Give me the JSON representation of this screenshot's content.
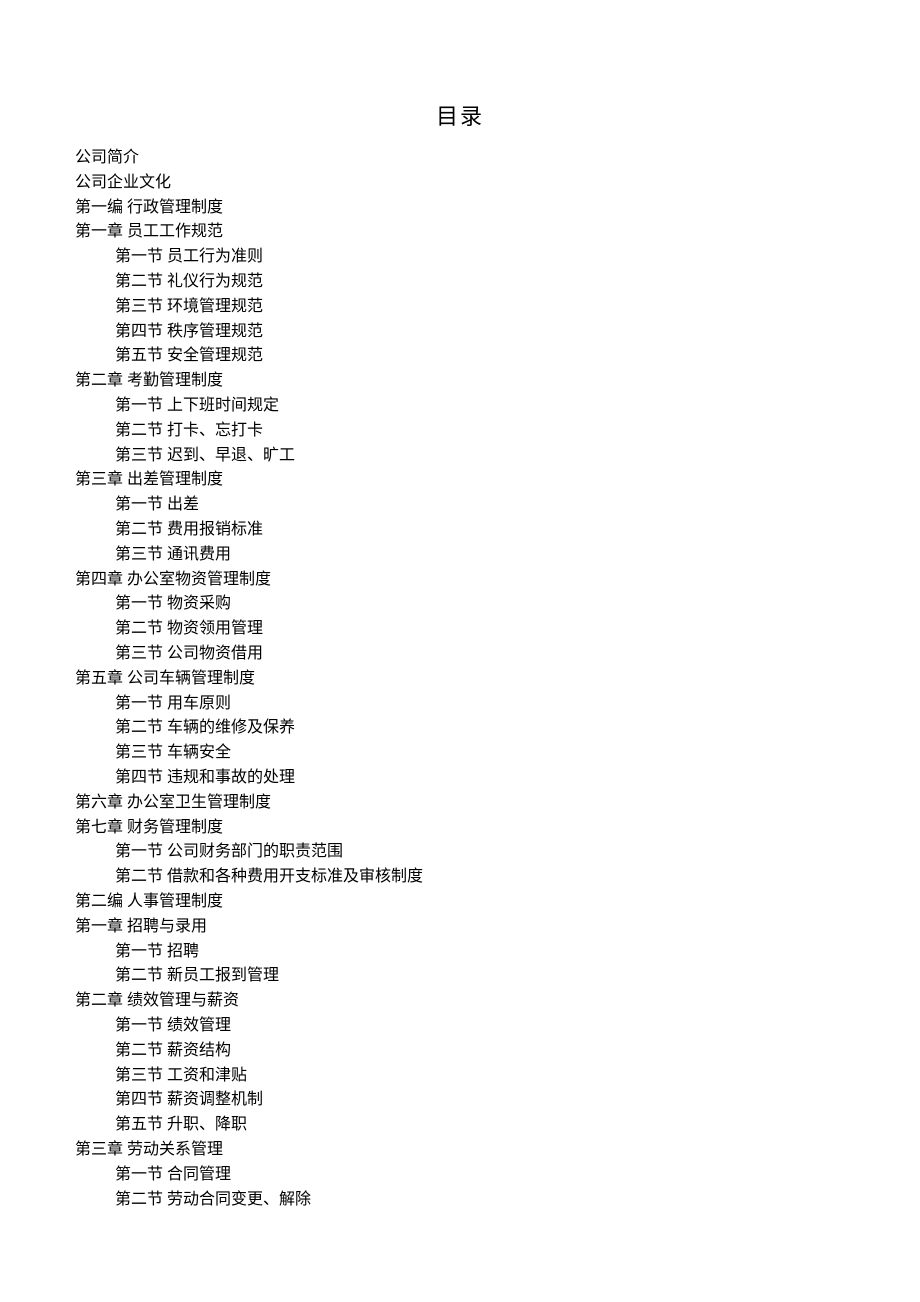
{
  "title": "目录",
  "items": [
    {
      "text": "公司简介",
      "level": 0
    },
    {
      "text": "公司企业文化",
      "level": 0
    },
    {
      "text": "第一编 行政管理制度",
      "level": 0
    },
    {
      "text": "第一章 员工工作规范",
      "level": 0
    },
    {
      "text": "第一节 员工行为准则",
      "level": 1
    },
    {
      "text": "第二节 礼仪行为规范",
      "level": 1
    },
    {
      "text": "第三节 环境管理规范",
      "level": 1
    },
    {
      "text": "第四节 秩序管理规范",
      "level": 1
    },
    {
      "text": "第五节 安全管理规范",
      "level": 1
    },
    {
      "text": "第二章 考勤管理制度",
      "level": 0
    },
    {
      "text": "第一节 上下班时间规定",
      "level": 1
    },
    {
      "text": "第二节 打卡、忘打卡",
      "level": 1
    },
    {
      "text": "第三节 迟到、早退、旷工",
      "level": 1
    },
    {
      "text": "第三章 出差管理制度",
      "level": 0
    },
    {
      "text": "第一节 出差",
      "level": 1
    },
    {
      "text": "第二节 费用报销标准",
      "level": 1
    },
    {
      "text": "第三节 通讯费用",
      "level": 1
    },
    {
      "text": "第四章 办公室物资管理制度",
      "level": 0
    },
    {
      "text": "第一节 物资采购",
      "level": 1
    },
    {
      "text": "第二节 物资领用管理",
      "level": 1
    },
    {
      "text": "第三节 公司物资借用",
      "level": 1
    },
    {
      "text": "第五章 公司车辆管理制度",
      "level": 0
    },
    {
      "text": "第一节 用车原则",
      "level": 1
    },
    {
      "text": "第二节 车辆的维修及保养",
      "level": 1
    },
    {
      "text": "第三节 车辆安全",
      "level": 1
    },
    {
      "text": "第四节 违规和事故的处理",
      "level": 1
    },
    {
      "text": "第六章 办公室卫生管理制度",
      "level": 0
    },
    {
      "text": "第七章 财务管理制度",
      "level": 0
    },
    {
      "text": "第一节 公司财务部门的职责范围",
      "level": 1
    },
    {
      "text": "第二节 借款和各种费用开支标准及审核制度",
      "level": 1
    },
    {
      "text": "第二编 人事管理制度",
      "level": 0
    },
    {
      "text": "第一章 招聘与录用",
      "level": 0
    },
    {
      "text": "第一节 招聘",
      "level": 1
    },
    {
      "text": "第二节 新员工报到管理",
      "level": 1
    },
    {
      "text": "第二章 绩效管理与薪资",
      "level": 0
    },
    {
      "text": "第一节 绩效管理",
      "level": 1
    },
    {
      "text": "第二节 薪资结构",
      "level": 1
    },
    {
      "text": "第三节 工资和津贴",
      "level": 1
    },
    {
      "text": "第四节 薪资调整机制",
      "level": 1
    },
    {
      "text": "第五节 升职、降职",
      "level": 1
    },
    {
      "text": "第三章 劳动关系管理",
      "level": 0
    },
    {
      "text": "第一节 合同管理",
      "level": 1
    },
    {
      "text": "第二节 劳动合同变更、解除",
      "level": 1
    }
  ]
}
